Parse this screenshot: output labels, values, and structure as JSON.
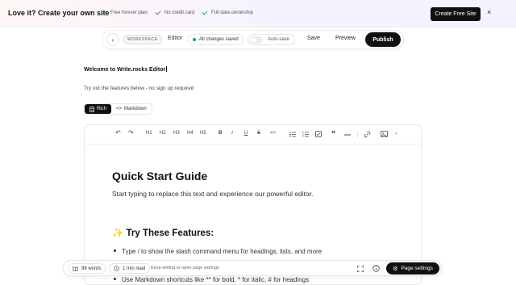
{
  "banner": {
    "title": "Love it? Create your own site",
    "perks": [
      "Free forever plan",
      "No credit card",
      "Full data ownership"
    ],
    "cta_label": "Create Free Site",
    "close_glyph": "×"
  },
  "topbar": {
    "back_glyph": "‹",
    "workspace_badge": "WORKSPACE",
    "editor_label": "Editor",
    "saved_status": "All changes saved",
    "autosave_label": "Auto-save",
    "save_label": "Save",
    "preview_label": "Preview",
    "publish_label": "Publish"
  },
  "intro": {
    "welcome": "Welcome to Write.rocks Editor",
    "tryout": "Try out the features below - no sign up required"
  },
  "mode_tabs": {
    "rich_label": "Rich",
    "markdown_label": "Markdown",
    "active": "Rich"
  },
  "format_toolbar": {
    "undo": "↶",
    "redo": "↷",
    "h1": "H1",
    "h2": "H2",
    "h3": "H3",
    "h4": "H4",
    "h5": "H5",
    "bold": "B",
    "italic": "I",
    "underline": "U",
    "strike": "S",
    "code": "<>",
    "more": "⌄"
  },
  "document": {
    "heading": "Quick Start Guide",
    "intro_text": "Start typing to replace this text and experience our powerful editor.",
    "section_heading": "✨ Try These Features:",
    "item1": "Type / to show the slash command menu for headings, lists, and more",
    "item2": "Use Markdown shortcuts like ** for bold, * for italic, # for headings"
  },
  "status_bar": {
    "words": "96 words",
    "read_time": "1 min read",
    "hint": "Keep writing or open page settings",
    "page_settings_label": "Page settings"
  },
  "colors": {
    "accent_dark": "#111111",
    "success_green": "#22a06b"
  }
}
